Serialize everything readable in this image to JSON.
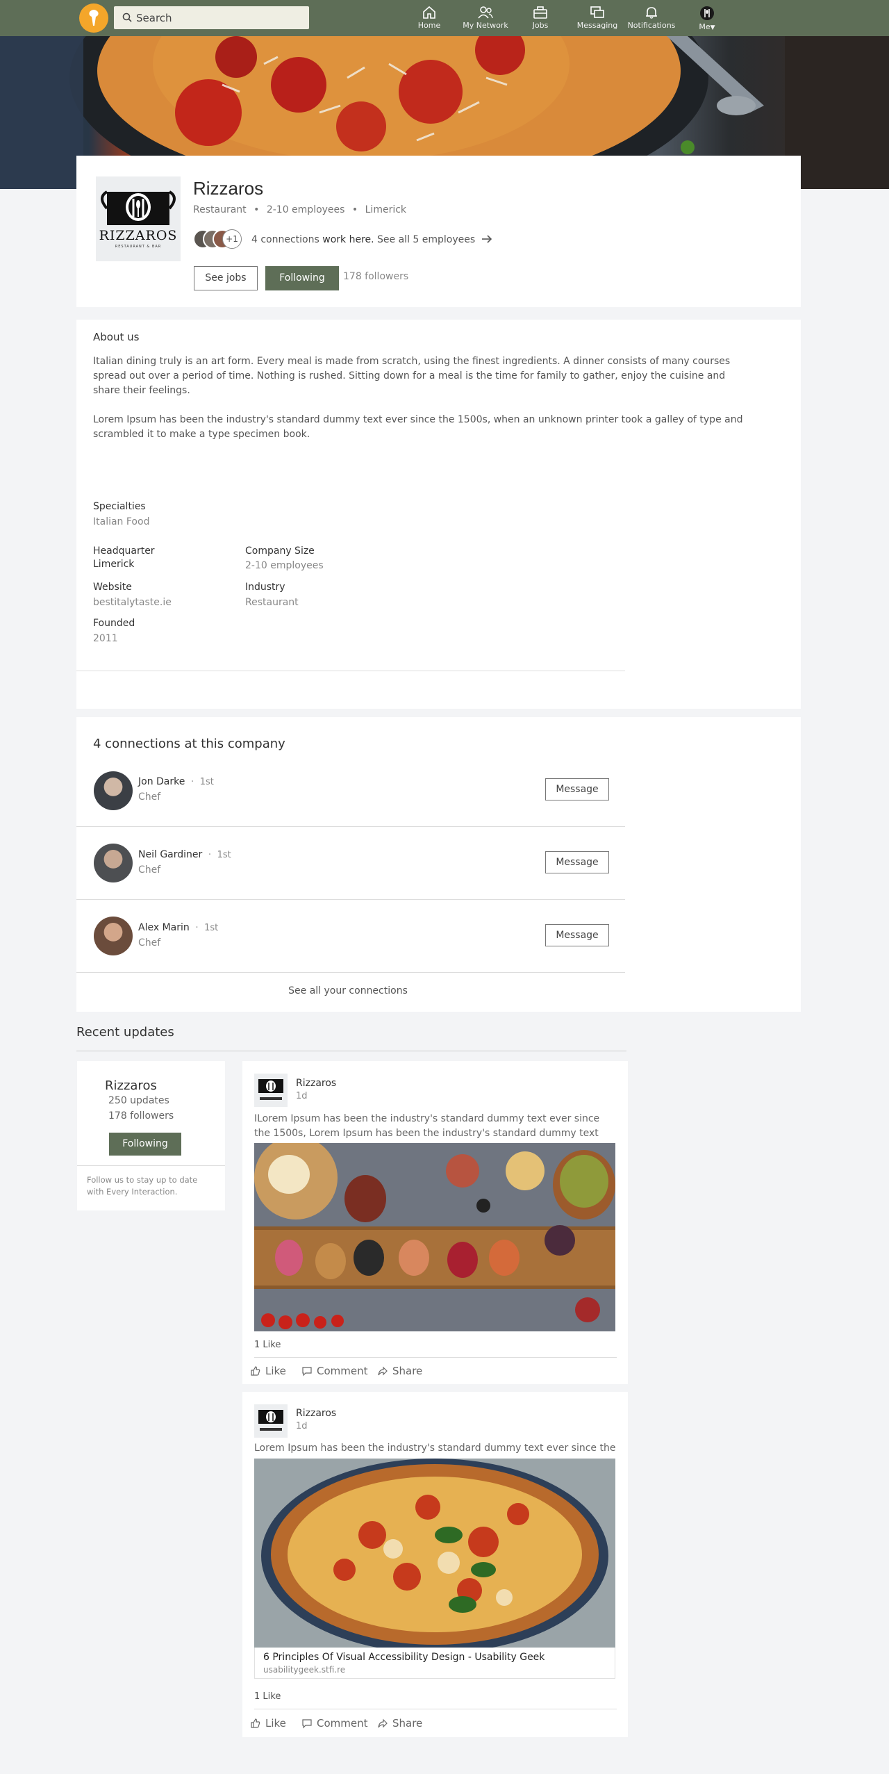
{
  "nav": {
    "search_placeholder": "Search",
    "items": [
      {
        "label": "Home",
        "icon": "home-icon"
      },
      {
        "label": "My Network",
        "icon": "network-icon"
      },
      {
        "label": "Jobs",
        "icon": "briefcase-icon"
      },
      {
        "label": "Messaging",
        "icon": "messaging-icon"
      },
      {
        "label": "Notifications",
        "icon": "bell-icon"
      },
      {
        "label": "Me",
        "icon": "avatar"
      }
    ]
  },
  "company": {
    "logo_text": "RIZZAROS",
    "logo_subtext": "RESTAURANT & BAR",
    "name": "Rizzaros",
    "type": "Restaurant",
    "size": "2-10 employees",
    "location": "Limerick",
    "extra_connections": "+1",
    "connections_text": "4 connections",
    "work_here": "work here.",
    "see_all": "See all 5 employees",
    "see_jobs": "See jobs",
    "following": "Following",
    "followers": "178 followers"
  },
  "about": {
    "title": "About us",
    "p1": "Italian dining truly is an art form. Every meal is made from scratch, using the finest ingredients. A dinner consists of many courses spread out over a period of time. Nothing is rushed. Sitting down for a meal is the time for family to gather, enjoy the cuisine and share their feelings.",
    "p2": "Lorem Ipsum has been the industry's standard dummy text ever since the 1500s, when an unknown printer took a galley of type and scrambled it to make a type specimen book.",
    "specialties_label": "Specialties",
    "specialties": "Italian Food",
    "hq_label": "Headquarter",
    "hq": "Limerick",
    "size_label": "Company Size",
    "size": "2-10 employees",
    "website_label": "Website",
    "website": "bestitalytaste.ie",
    "industry_label": "Industry",
    "industry": "Restaurant",
    "founded_label": "Founded",
    "founded": "2011"
  },
  "connections": {
    "title": "4 connections at this company",
    "people": [
      {
        "name": "Jon Darke",
        "degree": "1st",
        "role": "Chef",
        "button": "Message"
      },
      {
        "name": "Neil Gardiner",
        "degree": "1st",
        "role": "Chef",
        "button": "Message"
      },
      {
        "name": "Alex Marin",
        "degree": "1st",
        "role": "Chef",
        "button": "Message"
      }
    ],
    "see_all": "See all your connections"
  },
  "recent": {
    "title": "Recent updates",
    "sidebar": {
      "name": "Rizzaros",
      "updates": "250 updates",
      "followers": "178 followers",
      "following": "Following",
      "note": "Follow us to stay up to date with Every Interaction."
    },
    "posts": [
      {
        "author": "Rizzaros",
        "time": "1d",
        "text": "ILorem Ipsum has been the industry's standard dummy text ever since the 1500s,  Lorem Ipsum has been the industry's standard dummy text ever",
        "likes": "1 Like",
        "like": "Like",
        "comment": "Comment",
        "share": "Share"
      },
      {
        "author": "Rizzaros",
        "time": "1d",
        "text": "Lorem Ipsum has been the industry's standard dummy text ever since the",
        "link_title": "6 Principles Of Visual Accessibility Design - Usability Geek",
        "link_url": "usabilitygeek.stfi.re",
        "likes": "1 Like",
        "like": "Like",
        "comment": "Comment",
        "share": "Share"
      }
    ]
  },
  "colors": {
    "brand": "#5e6e57",
    "logo": "#f4a62a",
    "search_bg": "#efeee3"
  }
}
